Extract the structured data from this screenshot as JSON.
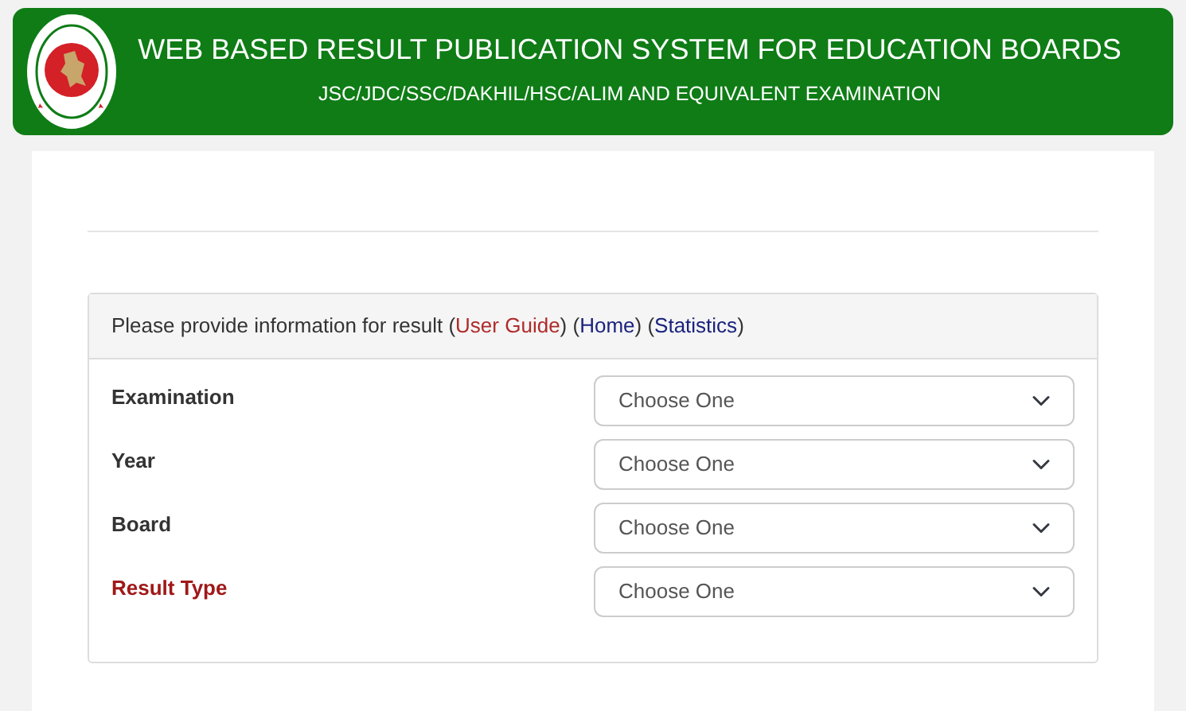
{
  "header": {
    "title": "WEB BASED RESULT PUBLICATION SYSTEM FOR EDUCATION BOARDS",
    "subtitle": "JSC/JDC/SSC/DAKHIL/HSC/ALIM AND EQUIVALENT EXAMINATION"
  },
  "form_heading": [
    {
      "kind": "text",
      "text": "Please provide information for result ("
    },
    {
      "kind": "link",
      "text": "User Guide",
      "color": "#b02a2a"
    },
    {
      "kind": "text",
      "text": ") ("
    },
    {
      "kind": "link",
      "text": "Home",
      "color": "#1a237e"
    },
    {
      "kind": "text",
      "text": ") ("
    },
    {
      "kind": "link",
      "text": "Statistics",
      "color": "#1a237e"
    },
    {
      "kind": "text",
      "text": ")"
    }
  ],
  "fields": [
    {
      "label": "Examination",
      "highlighted": false,
      "value": "Choose One"
    },
    {
      "label": "Year",
      "highlighted": false,
      "value": "Choose One"
    },
    {
      "label": "Board",
      "highlighted": false,
      "value": "Choose One"
    },
    {
      "label": "Result Type",
      "highlighted": true,
      "value": "Choose One"
    }
  ]
}
